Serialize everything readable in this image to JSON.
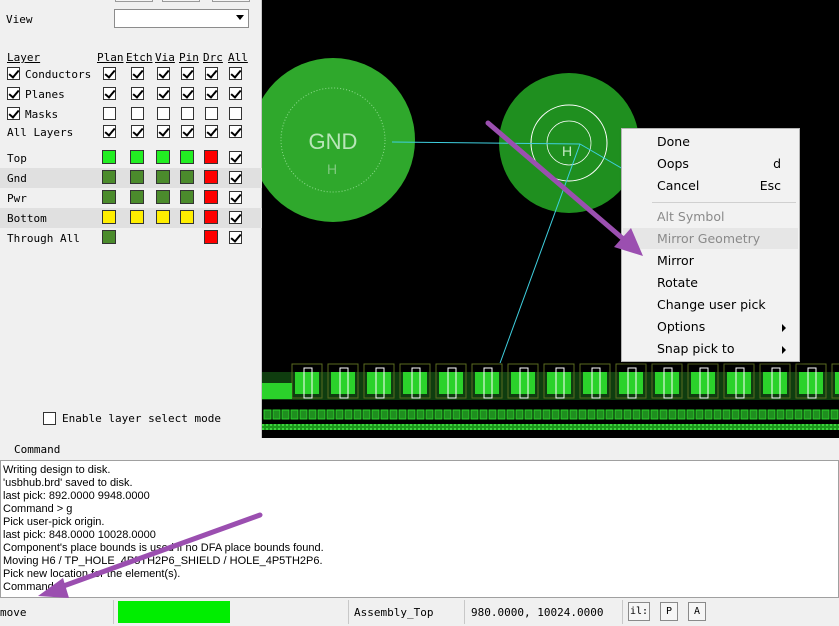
{
  "view": {
    "label": "View",
    "selected": ""
  },
  "columns": [
    "Plan",
    "Etch",
    "Via",
    "Pin",
    "Drc",
    "All"
  ],
  "header_label": "Layer",
  "groups": [
    {
      "label": "Conductors",
      "checked": true,
      "cols": [
        true,
        true,
        true,
        true,
        true,
        true
      ]
    },
    {
      "label": "Planes",
      "checked": true,
      "cols": [
        true,
        true,
        true,
        true,
        true,
        true
      ]
    },
    {
      "label": "Masks",
      "checked": true,
      "cols": [
        false,
        false,
        false,
        false,
        false,
        false
      ]
    },
    {
      "label": "All Layers",
      "checked": null,
      "cols": [
        true,
        true,
        true,
        true,
        true,
        true
      ]
    }
  ],
  "layers": [
    {
      "label": "Top",
      "swatches": [
        "#22ee22",
        "#22ee22",
        "#22ee22",
        "#22ee22",
        "#ff0000"
      ],
      "all": true
    },
    {
      "label": "Gnd",
      "swatches": [
        "#4b8b2c",
        "#4b8b2c",
        "#4b8b2c",
        "#4b8b2c",
        "#ff0000"
      ],
      "all": true
    },
    {
      "label": "Pwr",
      "swatches": [
        "#4b8b2c",
        "#4b8b2c",
        "#4b8b2c",
        "#4b8b2c",
        "#ff0000"
      ],
      "all": true
    },
    {
      "label": "Bottom",
      "swatches": [
        "#ffee00",
        "#ffee00",
        "#ffee00",
        "#ffee00",
        "#ff0000"
      ],
      "all": true
    },
    {
      "label": "Through All",
      "swatches": [
        "#4b8b2c",
        null,
        null,
        null,
        "#ff0000"
      ],
      "all": true
    }
  ],
  "enable_layer_select": {
    "label": "Enable layer select mode",
    "checked": false
  },
  "canvas": {
    "gnd_label": "GND",
    "h_label": "H"
  },
  "menu": {
    "items": [
      {
        "label": "Done",
        "shortcut": "",
        "disabled": false,
        "submenu": false
      },
      {
        "label": "Oops",
        "shortcut": "d",
        "disabled": false,
        "submenu": false
      },
      {
        "label": "Cancel",
        "shortcut": "Esc",
        "disabled": false,
        "submenu": false
      },
      {
        "label": "Alt Symbol",
        "shortcut": "",
        "disabled": true,
        "submenu": false
      },
      {
        "label": "Mirror Geometry",
        "shortcut": "",
        "disabled": true,
        "submenu": false
      },
      {
        "label": "Mirror",
        "shortcut": "",
        "disabled": false,
        "submenu": false
      },
      {
        "label": "Rotate",
        "shortcut": "",
        "disabled": false,
        "submenu": false
      },
      {
        "label": "Change user pick",
        "shortcut": "",
        "disabled": false,
        "submenu": false
      },
      {
        "label": "Options",
        "shortcut": "",
        "disabled": false,
        "submenu": true
      },
      {
        "label": "Snap pick to",
        "shortcut": "",
        "disabled": false,
        "submenu": true
      }
    ]
  },
  "command": {
    "label": "Command",
    "lines": [
      "Writing design to disk.",
      "'usbhub.brd' saved to disk.",
      "last pick:  892.0000 9948.0000",
      "Command > g",
      "Pick user-pick origin.",
      "last pick:  848.0000 10028.0000",
      "Component's place bounds is used if no DFA place bounds found.",
      "Moving H6 / TP_HOLE_4P5TH2P6_SHIELD / HOLE_4P5TH2P6.",
      "Pick new location for the element(s).",
      "Command >"
    ]
  },
  "status": {
    "mode": "move",
    "active_layer": "Assembly_Top",
    "coordinates": "980.0000, 10024.0000",
    "btn_left": "il:",
    "btn_p": "P",
    "btn_a": "A"
  },
  "colors": {
    "pad_green": "#2ea82a",
    "pad_dark_green": "#1c8a1c",
    "ratsnest": "#3fd0e0",
    "arrow": "#9b4fb0"
  }
}
